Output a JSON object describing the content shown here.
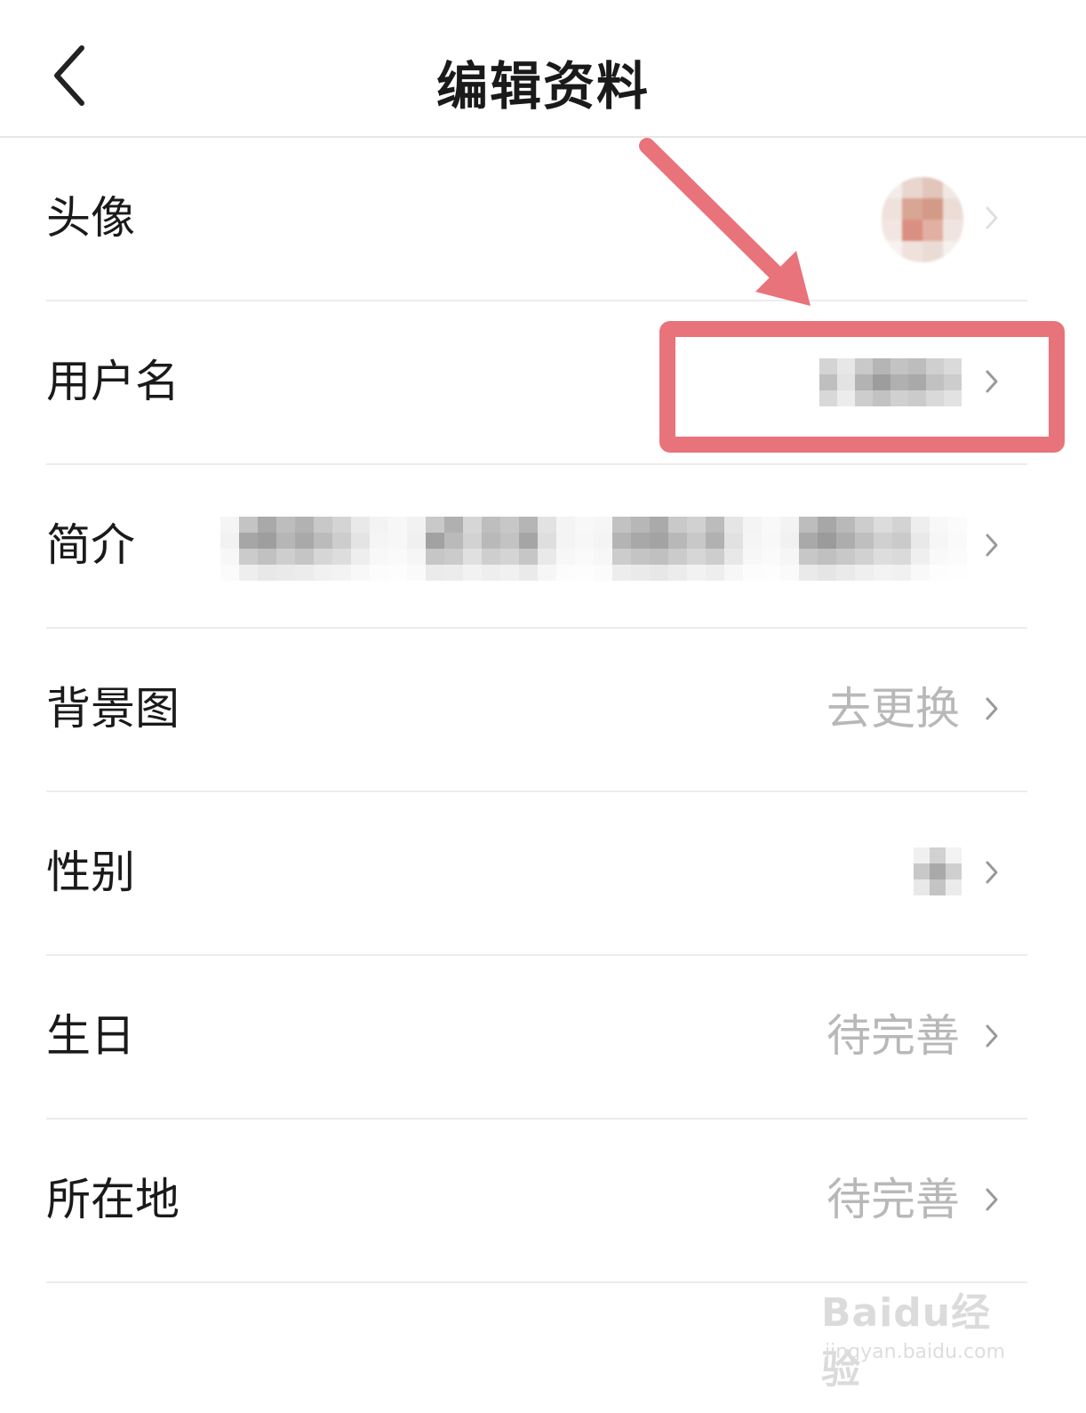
{
  "header": {
    "title": "编辑资料",
    "back_icon": "chevron-left-icon"
  },
  "rows": [
    {
      "label": "头像",
      "value": ""
    },
    {
      "label": "用户名",
      "value": ""
    },
    {
      "label": "简介",
      "value": ""
    },
    {
      "label": "背景图",
      "value": "去更换"
    },
    {
      "label": "性别",
      "value": ""
    },
    {
      "label": "生日",
      "value": "待完善"
    },
    {
      "label": "所在地",
      "value": "待完善"
    }
  ],
  "watermark": {
    "brand": "Baidu经验",
    "url": "jingyan.baidu.com"
  },
  "colors": {
    "highlight": "#e8737b",
    "value_gray": "#b8b8b8",
    "divider": "#ececec"
  }
}
